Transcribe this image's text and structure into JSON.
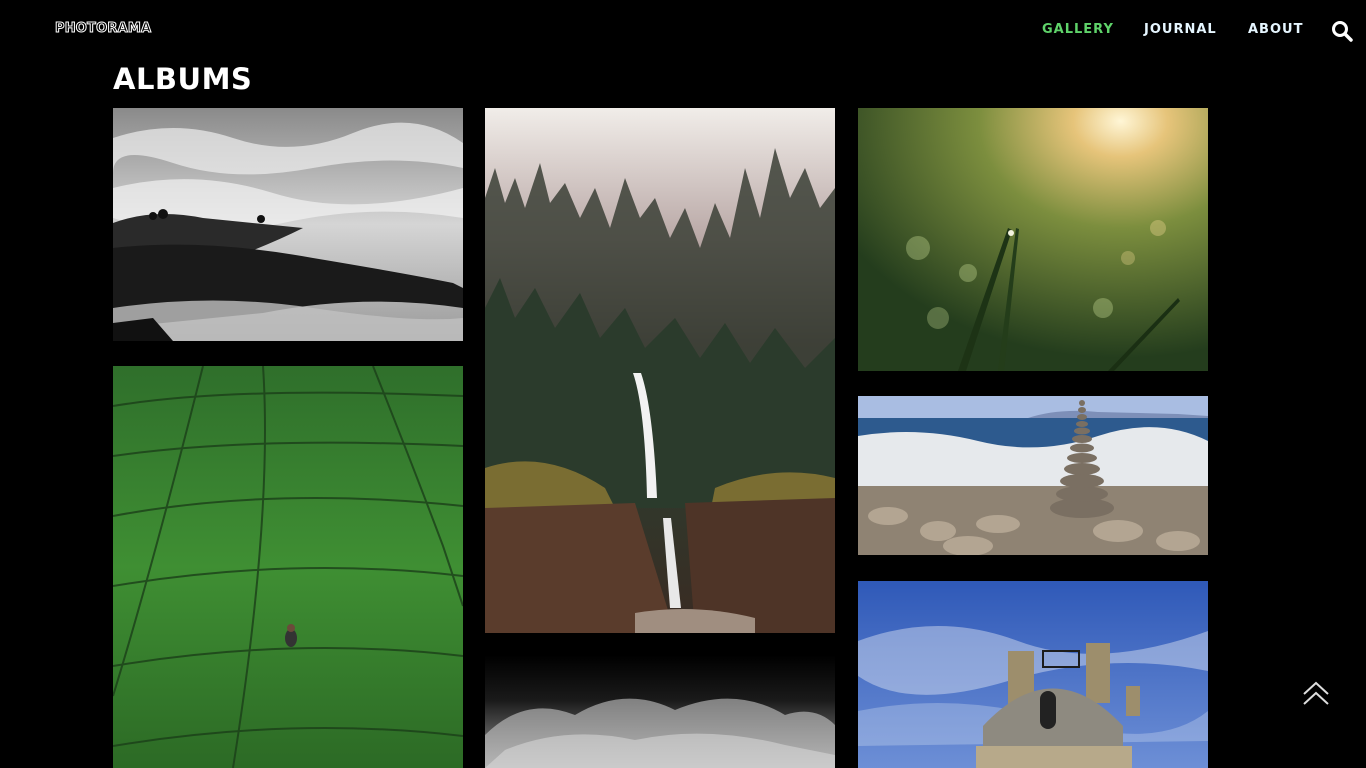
{
  "header": {
    "logo": "PHOTORAMA",
    "nav": [
      {
        "label": "GALLERY",
        "active": true
      },
      {
        "label": "JOURNAL",
        "active": false
      },
      {
        "label": "ABOUT",
        "active": false
      }
    ],
    "search_icon": "search-icon"
  },
  "main": {
    "title": "ALBUMS",
    "albums": [
      {
        "subject": "cloud-sea-hills"
      },
      {
        "subject": "forest-waterfall"
      },
      {
        "subject": "dew-grass-sunset"
      },
      {
        "subject": "tea-plantation"
      },
      {
        "subject": "stacked-stones-beach"
      },
      {
        "subject": "dark-clouds"
      },
      {
        "subject": "dome-building-sky"
      }
    ]
  },
  "scroll_top_icon": "double-chevron-up-icon",
  "colors": {
    "background": "#000000",
    "nav_active": "#5fd36a",
    "nav_text": "#e6f6ff"
  }
}
